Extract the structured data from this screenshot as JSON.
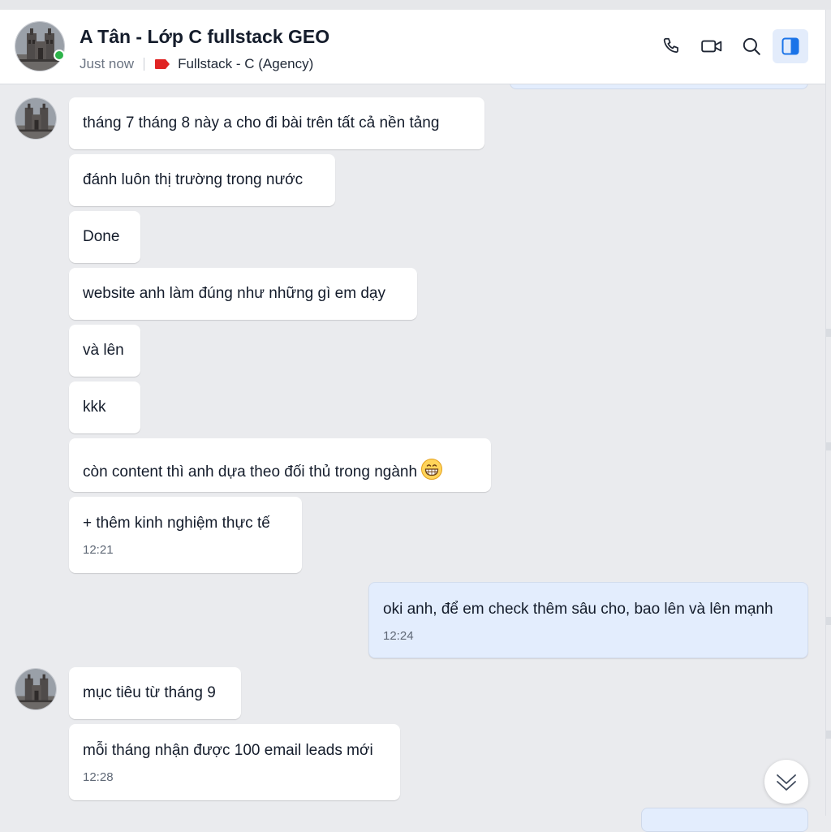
{
  "header": {
    "title": "A Tân - Lớp C fullstack GEO",
    "status": "Just now",
    "tag_label": "Fullstack - C (Agency)",
    "tag_color": "#e02424",
    "online_color": "#2db34a",
    "buttons": [
      "phone-icon",
      "video-call-icon",
      "search-icon",
      "sidebar-toggle-icon"
    ]
  },
  "messages": [
    {
      "side": "received",
      "text": "tháng 7 tháng 8 này a  cho đi bài trên tất cả nền tảng"
    },
    {
      "side": "received",
      "text": "đánh luôn thị trường trong nước"
    },
    {
      "side": "received",
      "text": "Done"
    },
    {
      "side": "received",
      "text": "website anh làm đúng như những gì em dạy"
    },
    {
      "side": "received",
      "text": "và lên"
    },
    {
      "side": "received",
      "text": "kkk"
    },
    {
      "side": "received",
      "text": "còn content thì anh dựa theo đối thủ trong ngành",
      "emoji": "grinning-face-emoji"
    },
    {
      "side": "received",
      "text": "+ thêm kinh nghiệm thực tế",
      "time": "12:21"
    },
    {
      "side": "sent",
      "text": "oki anh, để em check thêm sâu cho, bao lên và lên mạnh",
      "time": "12:24"
    },
    {
      "side": "received",
      "text": "mục tiêu từ tháng 9"
    },
    {
      "side": "received",
      "text": "mỗi tháng nhận được 100 email leads mới",
      "time": "12:28"
    }
  ],
  "colors": {
    "background": "#eaebee",
    "received_bubble": "#ffffff",
    "sent_bubble": "#e3edfd",
    "accent": "#1a73e8"
  },
  "scroll_button_icon": "double-chevron-down-icon"
}
